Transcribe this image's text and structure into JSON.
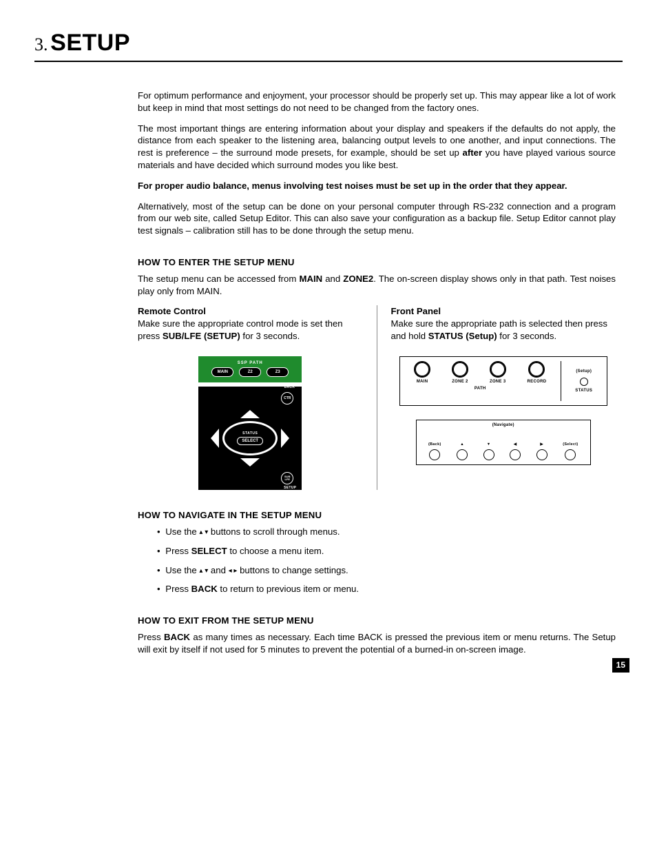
{
  "title": {
    "number": "3.",
    "word": "SETUP"
  },
  "intro": {
    "p1": "For optimum performance and enjoyment, your processor should be properly set up. This may appear like a lot of work but keep in mind that most settings do not need to be changed from the factory ones.",
    "p2a": "The most important things are entering information about your display and speakers if the defaults do not apply, the distance from each speaker to the listening area, balancing output levels to one another, and input connections. The rest is preference – the surround mode presets, for example, should be set up ",
    "p2_bold": "after",
    "p2b": " you have played various source materials and have decided which surround modes you like best.",
    "p3_bold": "For proper audio balance, menus involving test noises must be set up in the order that they appear.",
    "p4": "Alternatively, most of the setup can be done on your personal computer through RS-232 connection and a program from our web site, called Setup Editor. This can also save your configuration as a backup file. Setup Editor cannot play test signals – calibration still has to be done through the setup menu."
  },
  "enter": {
    "heading": "HOW TO ENTER THE SETUP MENU",
    "body_a": "The setup menu can be accessed from ",
    "b1": "MAIN",
    "body_b": " and ",
    "b2": "ZONE2",
    "body_c": ". The on-screen display shows only in that path. Test noises play only from MAIN.",
    "remote": {
      "title": "Remote Control",
      "line_a": "Make sure the appropriate control mode is set then press ",
      "line_bold": "SUB/LFE (SETUP)",
      "line_b": " for 3 seconds.",
      "ssp_label": "SSP PATH",
      "ssp_buttons": [
        "MAIN",
        "Z2",
        "Z3"
      ],
      "dpad": {
        "status": "STATUS",
        "select": "SELECT",
        "back": "BACK",
        "ctr": "CTR",
        "setup": "SETUP",
        "sublfe": "SUB\nLFE"
      }
    },
    "front": {
      "title": "Front Panel",
      "line_a": "Make sure the appropriate path is selected then press and hold ",
      "line_bold": "STATUS (Setup)",
      "line_b": " for 3 seconds.",
      "knobs": [
        "MAIN",
        "ZONE 2",
        "ZONE 3",
        "RECORD"
      ],
      "path_label": "PATH",
      "setup_paren": "(Setup)",
      "status_label": "STATUS",
      "nav_label": "(Navigate)",
      "nav_buttons": [
        "(Back)",
        "▲",
        "▼",
        "◀",
        "▶",
        "(Select)"
      ]
    }
  },
  "navigate": {
    "heading": "HOW TO NAVIGATE IN THE SETUP MENU",
    "items": {
      "i1a": "Use the ",
      "i1b": " buttons to scroll through menus.",
      "i2a": "Press ",
      "i2bold": "SELECT",
      "i2b": " to choose a menu item.",
      "i3a": "Use the ",
      "i3b": " and ",
      "i3c": " buttons to change settings.",
      "i4a": "Press ",
      "i4bold": "BACK",
      "i4b": " to return to previous item or menu."
    }
  },
  "exit": {
    "heading": "HOW TO EXIT FROM THE SETUP MENU",
    "body_a": "Press ",
    "body_bold": "BACK",
    "body_b": " as many times as necessary. Each time BACK is pressed the previous item or menu returns. The Setup will exit by itself if not used for 5 minutes to prevent the potential of a burned-in on-screen image."
  },
  "page_number": "15"
}
